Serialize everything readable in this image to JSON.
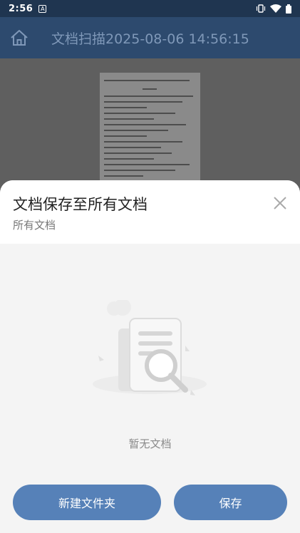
{
  "status_bar": {
    "time": "2:56",
    "notif_letter": "A"
  },
  "app_bar": {
    "title": "文档扫描2025-08-06 14:56:15"
  },
  "sheet": {
    "title": "文档保存至所有文档",
    "subtitle": "所有文档",
    "empty_text": "暂无文档",
    "new_folder_label": "新建文件夹",
    "save_label": "保存"
  },
  "colors": {
    "app_bar": "#2d4a6e",
    "button": "#5681b8",
    "sheet_bg": "#f4f4f4"
  },
  "icons": [
    "home-icon",
    "close-icon",
    "vibrate-icon",
    "wifi-icon",
    "battery-icon"
  ]
}
